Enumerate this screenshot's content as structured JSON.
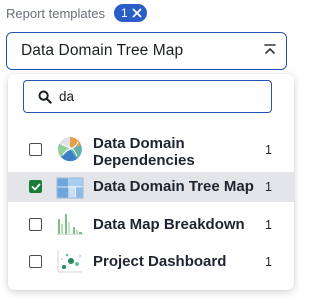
{
  "field": {
    "label": "Report templates",
    "selected_count": "1",
    "clear_icon": "close-icon"
  },
  "select": {
    "value": "Data Domain Tree Map",
    "toggle_icon": "collapse-icon"
  },
  "search": {
    "icon": "search-icon",
    "value": "da"
  },
  "options": [
    {
      "line1": "Data Domain",
      "line2": "Dependencies",
      "count": "1",
      "checked": false,
      "icon": "dependencies-thumbnail-icon"
    },
    {
      "line1": "Data Domain Tree Map",
      "count": "1",
      "checked": true,
      "icon": "tree-map-thumbnail-icon"
    },
    {
      "line1": "Data Map Breakdown",
      "count": "1",
      "checked": false,
      "icon": "breakdown-thumbnail-icon"
    },
    {
      "line1": "Project Dashboard",
      "count": "1",
      "checked": false,
      "icon": "dashboard-thumbnail-icon"
    }
  ],
  "colors": {
    "accent": "#2553b5",
    "chip": "#2a5ec6",
    "checked": "#1b7f3a",
    "selected_row": "#e3e5e8"
  }
}
